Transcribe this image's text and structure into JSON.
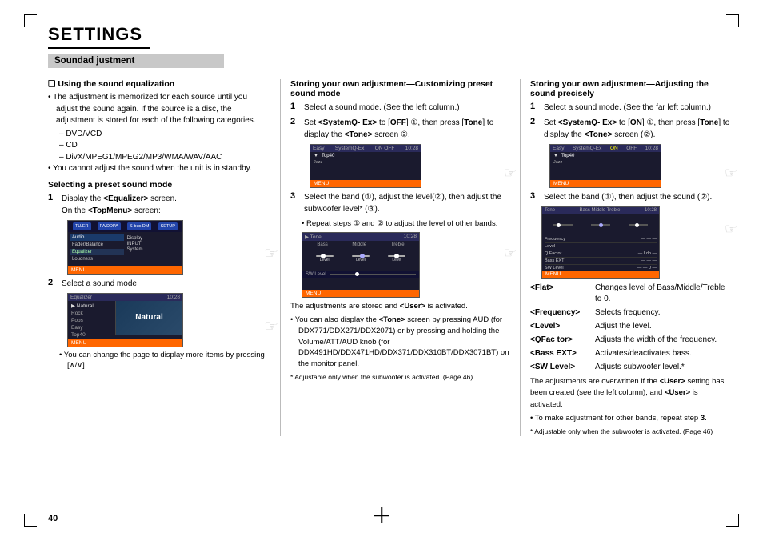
{
  "page": {
    "title": "SETTINGS",
    "section_bar": "Soundad justment",
    "page_number": "40"
  },
  "col1": {
    "sub_heading": "❑ Using the sound equalization",
    "bullets": [
      "The adjustment is memorized for each source until you adjust the sound again. If the source is a disc, the adjustment is stored for each of the following categories.",
      "– DVD/VCD",
      "– CD",
      "– DivX/MPEG1/MPEG2/MP3/WMA/WAV/AAC",
      "You cannot adjust the sound when the unit is in standby."
    ],
    "step1_heading": "Selecting a preset sound mode",
    "step1_label": "1",
    "step1_text": "Display the <Equalizer> screen.",
    "step1_sub": "On the <TopMenu> screen:",
    "step2_label": "2",
    "step2_text": "Select a sound mode",
    "step2_note": "You can change the page to display more items by pressing [∧/∨]."
  },
  "col2": {
    "heading": "Storing your own adjustment—Customizing preset sound mode",
    "step1_label": "1",
    "step1_text": "Select a sound mode. (See the left column.)",
    "step2_label": "2",
    "step2_text": "Set <SystemQ- Ex> to [OFF] ①, then press [Tone] to display the <Tone> screen ②.",
    "step3_label": "3",
    "step3_text": "Select the band (①), adjust the level(②), then adjust the subwoofer level* (③).",
    "step3_note": "Repeat steps ① and ② to adjust the level of other bands.",
    "note1": "The adjustments are stored and <User> is activated.",
    "note2": "You can also display the <Tone> screen by pressing AUD (for DDX771/DDX271/DDX2071) or by pressing and holding the Volume/ATT/AUD knob (for DDX491HD/DDX471HD/DDX371/DDX310BT/DDX3071BT) on the monitor panel.",
    "footnote": "* Adjustable only when the subwoofer is activated. (Page 46)"
  },
  "col3": {
    "heading": "Storing your own adjustment—Adjusting the sound precisely",
    "step1_label": "1",
    "step1_text": "Select a sound mode. (See the far left column.)",
    "step2_label": "2",
    "step2_text": "Set <SystemQ- Ex> to [ON] ①, then press [Tone] to display the <Tone> screen (②).",
    "step3_label": "3",
    "step3_text": "Select the band (①), then adjust the sound (②).",
    "definitions": [
      {
        "term": "<Flat>",
        "desc": "Changes level of Bass/Middle/Treble to 0."
      },
      {
        "term": "<Frequency>",
        "desc": "Selects frequency."
      },
      {
        "term": "<Level>",
        "desc": "Adjust the level."
      },
      {
        "term": "<QFactor>",
        "desc": "Adjusts the width of the frequency."
      },
      {
        "term": "<Bass EXT>",
        "desc": "Activates/deactivates bass."
      },
      {
        "term": "<SW Level>",
        "desc": "Adjusts subwoofer level.*"
      }
    ],
    "note1": "The adjustments are overwritten if the <User> setting has been created (see the left column), and <User> is activated.",
    "note2": "To make adjustment for other bands, repeat step 3.",
    "footnote": "* Adjustable only when the subwoofer is activated. (Page 46)"
  },
  "screens": {
    "topmenu_label": "TU/ER  PA/DDPA  S-bus DM  SETUP",
    "equalizer_label": "Equalizer",
    "soundmode_label": "Natural",
    "tone_label": "Tone",
    "tone_time": "10:28",
    "tone_bands": [
      "Bass",
      "Middle",
      "Treble"
    ],
    "systemq_label": "SystemQ-Ex",
    "on_label": "ON",
    "off_label": "OFF"
  }
}
